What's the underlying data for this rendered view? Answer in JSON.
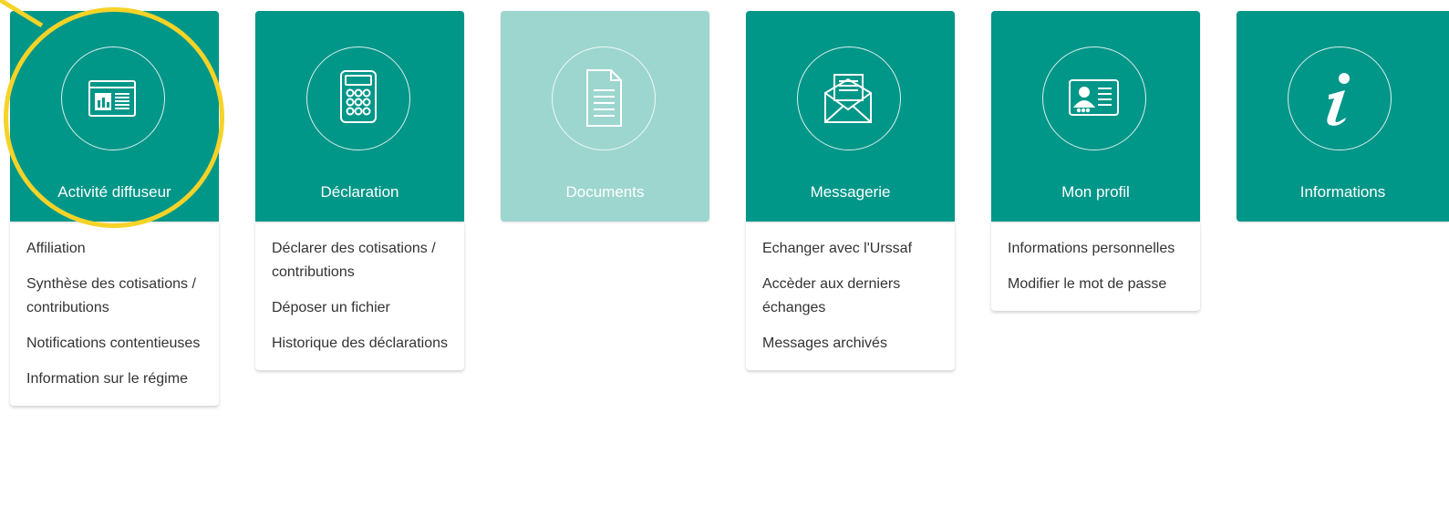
{
  "colors": {
    "tile_active": "#009688",
    "tile_disabled": "#9dd6cf",
    "highlight": "#f6d327",
    "menu_text": "#333333"
  },
  "tiles": [
    {
      "title": "Activité diffuseur",
      "icon": "dashboard-chart-icon",
      "menu": [
        "Affiliation",
        "Synthèse des cotisations / contributions",
        "Notifications contentieuses",
        "Information sur le régime"
      ]
    },
    {
      "title": "Déclaration",
      "icon": "calculator-icon",
      "menu": [
        "Déclarer des cotisations / contributions",
        "Déposer un fichier",
        "Historique des déclarations"
      ]
    },
    {
      "title": "Documents",
      "icon": "document-icon",
      "disabled": true,
      "menu": []
    },
    {
      "title": "Messagerie",
      "icon": "envelope-icon",
      "menu": [
        "Echanger avec l'Urssaf",
        "Accèder aux derniers échanges",
        "Messages archivés"
      ]
    },
    {
      "title": "Mon profil",
      "icon": "id-card-icon",
      "menu": [
        "Informations personnelles",
        "Modifier le mot de passe"
      ]
    },
    {
      "title": "Informations",
      "icon": "info-icon",
      "menu": []
    }
  ]
}
